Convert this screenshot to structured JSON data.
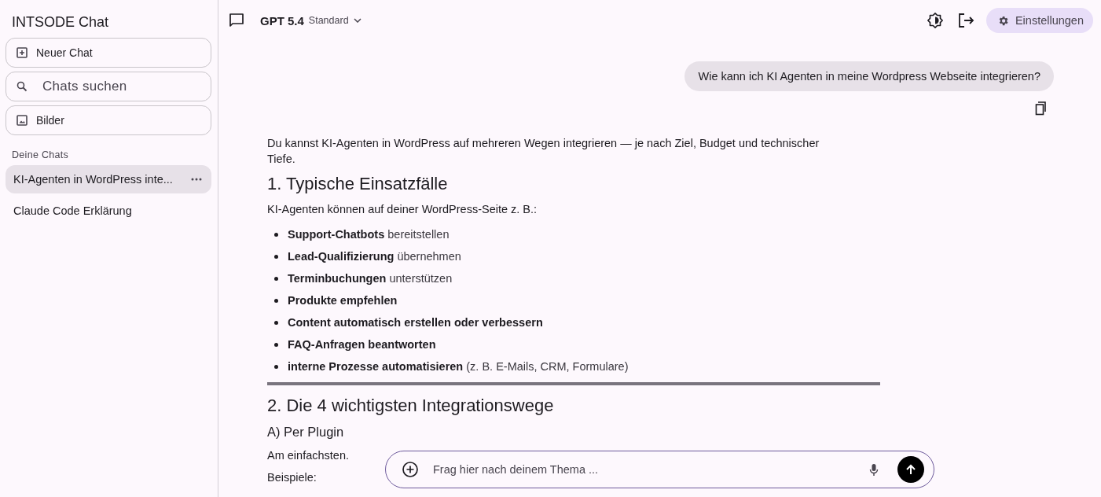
{
  "sidebar": {
    "title": "INTSODE Chat",
    "actions": [
      {
        "kind": "new",
        "label": "Neuer Chat"
      },
      {
        "kind": "search",
        "label": "Chats suchen"
      },
      {
        "kind": "images",
        "label": "Bilder"
      }
    ],
    "section_label": "Deine Chats",
    "chats": [
      {
        "title": "KI-Agenten in WordPress inte...",
        "selected": true
      },
      {
        "title": "Claude Code Erklärung",
        "selected": false
      }
    ]
  },
  "header": {
    "model": "GPT 5.4",
    "variant": "Standard",
    "settings_label": "Einstellungen"
  },
  "question": "Wie kann ich KI Agenten in meine Wordpress Webseite integrieren?",
  "answer": [
    {
      "kind": "paragraph",
      "text": "Du kannst KI-Agenten in WordPress auf mehreren Wegen integrieren — je nach Ziel, Budget und technischer Tiefe."
    },
    {
      "kind": "h1",
      "text": "1. Typische Einsatzfälle"
    },
    {
      "kind": "paragraph",
      "text": "KI-Agenten können auf deiner WordPress-Seite z. B.:"
    },
    {
      "kind": "list",
      "items": [
        {
          "strong": "Support-Chatbots",
          "rest": "bereitstellen"
        },
        {
          "strong": "Lead-Qualifizierung",
          "rest": "übernehmen"
        },
        {
          "strong": "Terminbuchungen",
          "rest": "unterstützen"
        },
        {
          "strong": "Produkte empfehlen"
        },
        {
          "strong": "Content automatisch erstellen oder verbessern"
        },
        {
          "strong": "FAQ-Anfragen beantworten"
        },
        {
          "strong": "interne Prozesse automatisieren",
          "rest": "(z. B. E-Mails, CRM, Formulare)"
        }
      ]
    },
    {
      "kind": "rule"
    },
    {
      "kind": "h1",
      "text": "2. Die 4 wichtigsten Integrationswege"
    },
    {
      "kind": "h3",
      "text": "A) Per Plugin"
    },
    {
      "kind": "paragraph",
      "text": "Am einfachsten."
    },
    {
      "kind": "paragraph",
      "text": "Beispiele:"
    }
  ],
  "composer": {
    "placeholder": "Frag hier nach deinem Thema ..."
  }
}
